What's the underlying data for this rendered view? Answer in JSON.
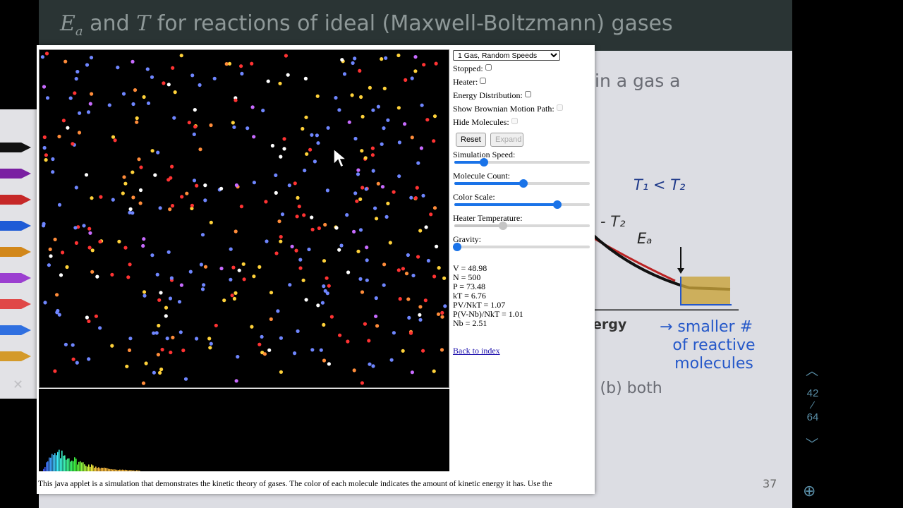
{
  "slide": {
    "title_prefix_italic": "E",
    "title_sub": "a",
    "title_mid": " and ",
    "title_T": "T",
    "title_rest": " for reactions of ideal (Maxwell-Boltzmann) gases",
    "line1": "in a gas a",
    "line2": "e (b) both",
    "axis_energy": "ergy",
    "t1_lt_t2": "T₁ < T₂",
    "t2_label": "- T₂",
    "ea_label": "Eₐ",
    "note": [
      "→ smaller #",
      "of reactive",
      "molecules"
    ],
    "page_number": "37",
    "nav_current": "42",
    "nav_total": "64",
    "colors": {
      "header_bg": "#2a3434",
      "slide_bg": "#dcdde3",
      "ink_blue": "#2558c9"
    }
  },
  "applet": {
    "mode_select": {
      "selected": "1 Gas, Random Speeds"
    },
    "checkboxes": [
      {
        "label": "Stopped:",
        "checked": false,
        "enabled": true
      },
      {
        "label": "Heater:",
        "checked": false,
        "enabled": true
      },
      {
        "label": "Energy Distribution:",
        "checked": false,
        "enabled": true
      },
      {
        "label": "Show Brownian Motion Path:",
        "checked": false,
        "enabled": false
      },
      {
        "label": "Hide Molecules:",
        "checked": false,
        "enabled": false
      }
    ],
    "buttons": {
      "reset": "Reset",
      "expand": "Expand"
    },
    "sliders": [
      {
        "label": "Simulation Speed:",
        "value": 0.22,
        "enabled": true
      },
      {
        "label": "Molecule Count:",
        "value": 0.51,
        "enabled": true
      },
      {
        "label": "Color Scale:",
        "value": 0.76,
        "enabled": true
      },
      {
        "label": "Heater Temperature:",
        "value": 0.36,
        "enabled": false
      },
      {
        "label": "Gravity:",
        "value": 0.02,
        "enabled": true
      }
    ],
    "stats": [
      "V = 48.98",
      "N = 500",
      "P = 73.48",
      "kT = 6.76",
      "PV/NkT = 1.07",
      "P(V-Nb)/NkT = 1.01",
      "Nb = 2.51"
    ],
    "back_link": "Back to index",
    "description": "This java applet is a simulation that demonstrates the kinetic theory of gases. The color of each molecule indicates the amount of kinetic energy it has. Use the",
    "molecule_colors": [
      "#6f86ff",
      "#ff3333",
      "#ffd23a",
      "#ff8c3a",
      "#ffffff",
      "#c86bff"
    ]
  }
}
